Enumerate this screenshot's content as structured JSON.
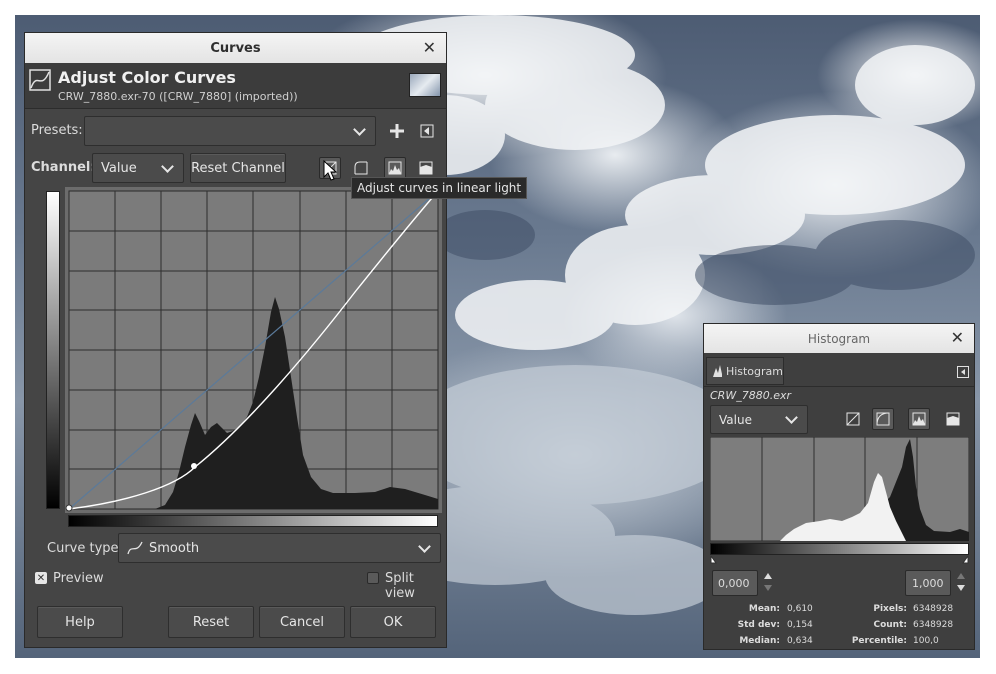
{
  "curves_dialog": {
    "title": "Curves",
    "header_title": "Adjust Color Curves",
    "header_subtitle": "CRW_7880.exr-70 ([CRW_7880] (imported))",
    "presets_label": "Presets:",
    "presets_value": "",
    "channel_label": "Channel:",
    "channel_value": "Value",
    "reset_channel": "Reset Channel",
    "tooltip": "Adjust curves in linear light",
    "curve_type_label": "Curve type:",
    "curve_type_value": "Smooth",
    "preview_label": "Preview",
    "preview_checked": true,
    "split_view_label": "Split view",
    "split_view_checked": false,
    "buttons": {
      "help": "Help",
      "reset": "Reset",
      "cancel": "Cancel",
      "ok": "OK"
    }
  },
  "histogram_dialog": {
    "title": "Histogram",
    "tab_label": "Histogram",
    "filename": "CRW_7880.exr",
    "channel_value": "Value",
    "range_low": "0,000",
    "range_high": "1,000",
    "stats": {
      "mean_label": "Mean:",
      "mean": "0,610",
      "stddev_label": "Std dev:",
      "stddev": "0,154",
      "median_label": "Median:",
      "median": "0,634",
      "pixels_label": "Pixels:",
      "pixels": "6348928",
      "count_label": "Count:",
      "count": "6348928",
      "percentile_label": "Percentile:",
      "percentile": "100,0"
    }
  },
  "colors": {
    "dialog_bg": "#454545",
    "titlebar": "#ececec",
    "graph_bg": "#7b7b7b",
    "histogram_fill": "#202020",
    "curve": "#ffffff",
    "diagonal": "#5b7a9a"
  }
}
